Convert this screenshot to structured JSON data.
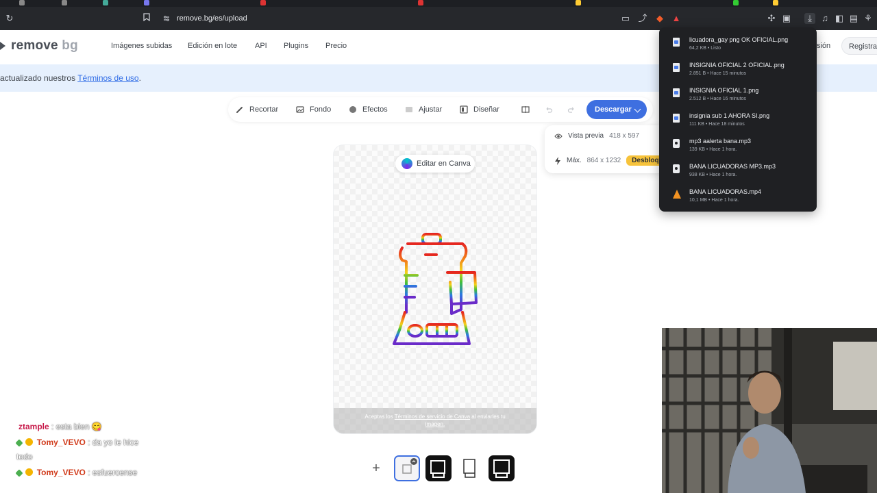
{
  "browser": {
    "url": "remove.bg/es/upload"
  },
  "header": {
    "logo_main": "remove",
    "logo_suffix": "bg",
    "nav": [
      "Imágenes subidas",
      "Edición en lote",
      "API",
      "Plugins",
      "Precio"
    ],
    "login_partial": "sión",
    "register": "Registrar"
  },
  "banner": {
    "text": "actualizado nuestros ",
    "link": "Términos de uso",
    "suffix": "."
  },
  "toolbar": {
    "crop": "Recortar",
    "background": "Fondo",
    "effects": "Efectos",
    "adjust": "Ajustar",
    "design": "Diseñar",
    "download": "Descargar"
  },
  "preview": {
    "preview_label": "Vista previa",
    "preview_dims": "418 x 597",
    "max_label": "Máx.",
    "max_dims": "864 x 1232",
    "unlock": "Desbloq"
  },
  "canvas": {
    "canva_button": "Editar en Canva",
    "footer_prefix": "Aceptas los ",
    "footer_link": "Términos de servicio de Canva",
    "footer_suffix": " al enviarles tu",
    "footer_line2": "imagen."
  },
  "chat": [
    {
      "user": "ztample",
      "message": ": esta bien 😋"
    },
    {
      "user": "Tomy_VEVO",
      "message": ": da yo le hice",
      "message2": "todo"
    },
    {
      "user": "Tomy_VEVO",
      "message": ": esfuercense"
    }
  ],
  "downloads": [
    {
      "name": "licuadora_gay png OK OFICIAL.png",
      "meta": "64,2 KB • Listo",
      "icon": "png"
    },
    {
      "name": "INSIGNIA OFICIAL 2 OFICIAL.png",
      "meta": "2.851 B • Hace 15 minutos",
      "icon": "png"
    },
    {
      "name": "INSIGNIA OFICIAL 1.png",
      "meta": "2.512 B • Hace 16 minutos",
      "icon": "png"
    },
    {
      "name": "insignia sub 1 AHORA SI.png",
      "meta": "111 KB • Hace 18 minutos",
      "icon": "png"
    },
    {
      "name": "mp3 aalerta bana.mp3",
      "meta": "139 KB • Hace 1 hora.",
      "icon": "mp3"
    },
    {
      "name": "BANA LICUADORAS MP3.mp3",
      "meta": "938 KB • Hace 1 hora.",
      "icon": "mp3"
    },
    {
      "name": "BANA LICUADORAS.mp4",
      "meta": "10,1 MB • Hace 1 hora.",
      "icon": "vlc"
    }
  ],
  "colors": {
    "accent": "#3e6fe0",
    "unlock": "#f7c33b",
    "banner": "#e6f0fd"
  }
}
